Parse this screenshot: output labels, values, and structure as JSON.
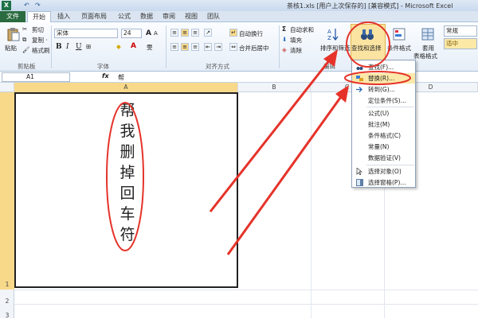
{
  "titlebar": {
    "logo": "X",
    "undo_icon": "↶",
    "redo_icon": "↷",
    "title": "茶核1.xls [用户上次保存的] [兼容模式] - Microsoft Excel"
  },
  "tabs": [
    {
      "label": "文件"
    },
    {
      "label": "开始"
    },
    {
      "label": "插入"
    },
    {
      "label": "页面布局"
    },
    {
      "label": "公式"
    },
    {
      "label": "数据"
    },
    {
      "label": "审阅"
    },
    {
      "label": "视图"
    },
    {
      "label": "团队"
    }
  ],
  "ribbon": {
    "clipboard": {
      "paste": "粘贴",
      "cut": "剪切",
      "copy": "复制 ·",
      "format_painter": "格式刷",
      "group_label": "剪贴板"
    },
    "font": {
      "font_name": "宋体",
      "font_size": "24",
      "bold": "B",
      "italic": "I",
      "underline": "U",
      "grow": "A",
      "shrink": "A",
      "font_color_icon": "A",
      "fill_color_icon": "◆",
      "phonetic": "雯",
      "group_label": "字体"
    },
    "alignment": {
      "wrap_text": "自动换行",
      "merge_center": "合并后居中",
      "group_label": "对齐方式"
    },
    "editing": {
      "autosum": "自动求和",
      "autosum_icon": "Σ",
      "fill": "填充",
      "clear": "清除",
      "sort_filter": "排序和筛选",
      "find_select": "查找和选择",
      "group_label": "编辑"
    },
    "styles": {
      "conditional_format": "条件格式",
      "table_format": "套用",
      "table_format_2": "表格格式",
      "style_normal": "常规",
      "style_medium": "适中"
    }
  },
  "formula_bar": {
    "name_box": "A1",
    "fx": "fx",
    "content": "帮"
  },
  "columns": [
    "A",
    "B",
    "C",
    "D"
  ],
  "rows": [
    "1",
    "2",
    "3"
  ],
  "cell_a1_lines": [
    "帮",
    "我",
    "删",
    "掉",
    "回",
    "车",
    "符"
  ],
  "dropdown": {
    "items": [
      {
        "label": "查找(F)...",
        "icon": "binoculars-icon"
      },
      {
        "label": "替换(R)...",
        "icon": "replace-icon"
      },
      {
        "label": "转到(G)...",
        "icon": "arrow-right-icon"
      },
      {
        "label": "定位条件(S)...",
        "icon": ""
      },
      {
        "label": "公式(U)",
        "icon": ""
      },
      {
        "label": "批注(M)",
        "icon": ""
      },
      {
        "label": "条件格式(C)",
        "icon": ""
      },
      {
        "label": "常量(N)",
        "icon": ""
      },
      {
        "label": "数据验证(V)",
        "icon": ""
      },
      {
        "label": "选择对象(O)",
        "icon": "pointer-icon"
      },
      {
        "label": "选择窗格(P)...",
        "icon": "pane-icon"
      }
    ],
    "highlight_index": 1
  },
  "colors": {
    "annotation_red": "#e5332a",
    "file_tab_green": "#2a6b3f",
    "selected_header": "#f8d98a",
    "dropdown_highlight": "#fce8a8"
  }
}
